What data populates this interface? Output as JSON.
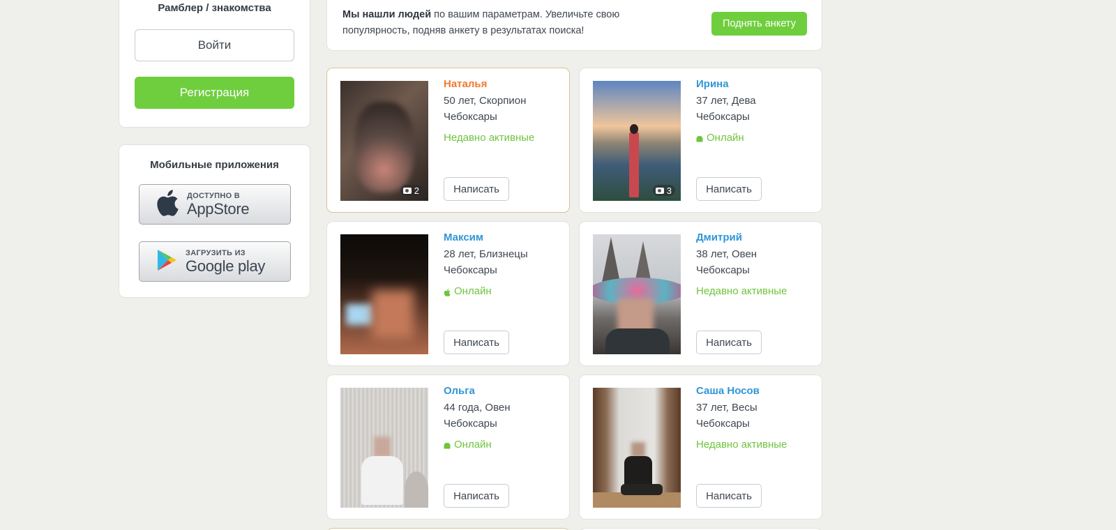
{
  "auth": {
    "title": "Рамблер / знакомства",
    "login_label": "Войти",
    "register_label": "Регистрация"
  },
  "apps": {
    "title": "Мобильные приложения",
    "appstore_small": "ДОСТУПНО В",
    "appstore_big": "AppStore",
    "googleplay_small": "ЗАГРУЗИТЬ ИЗ",
    "googleplay_big": "Google play"
  },
  "banner": {
    "bold": "Мы нашли людей",
    "text": " по вашим параметрам. Увеличьте свою популярность, подняв анкету в результатах поиска!",
    "button": "Поднять анкету"
  },
  "colors": {
    "accent_green": "#6fce3d",
    "link_blue": "#2f96d6",
    "highlight_orange": "#f07a2f",
    "status_green": "#6fc43c"
  },
  "profiles": [
    {
      "name": "Наталья",
      "age": "50 лет, Скорпион",
      "city": "Чебоксары",
      "status": "Недавно активные",
      "status_icon": "",
      "photo_count": "2",
      "write": "Написать"
    },
    {
      "name": "Ирина",
      "age": "37 лет, Дева",
      "city": "Чебоксары",
      "status": "Онлайн",
      "status_icon": "android-icon",
      "photo_count": "3",
      "write": "Написать"
    },
    {
      "name": "Максим",
      "age": "28 лет, Близнецы",
      "city": "Чебоксары",
      "status": "Онлайн",
      "status_icon": "apple-icon",
      "photo_count": "",
      "write": "Написать"
    },
    {
      "name": "Дмитрий",
      "age": "38 лет, Овен",
      "city": "Чебоксары",
      "status": "Недавно активные",
      "status_icon": "",
      "photo_count": "",
      "write": "Написать"
    },
    {
      "name": "Ольга",
      "age": "44 года, Овен",
      "city": "Чебоксары",
      "status": "Онлайн",
      "status_icon": "android-icon",
      "photo_count": "",
      "write": "Написать"
    },
    {
      "name": "Саша Носов",
      "age": "37 лет, Весы",
      "city": "Чебоксары",
      "status": "Недавно активные",
      "status_icon": "",
      "photo_count": "",
      "write": "Написать"
    }
  ]
}
